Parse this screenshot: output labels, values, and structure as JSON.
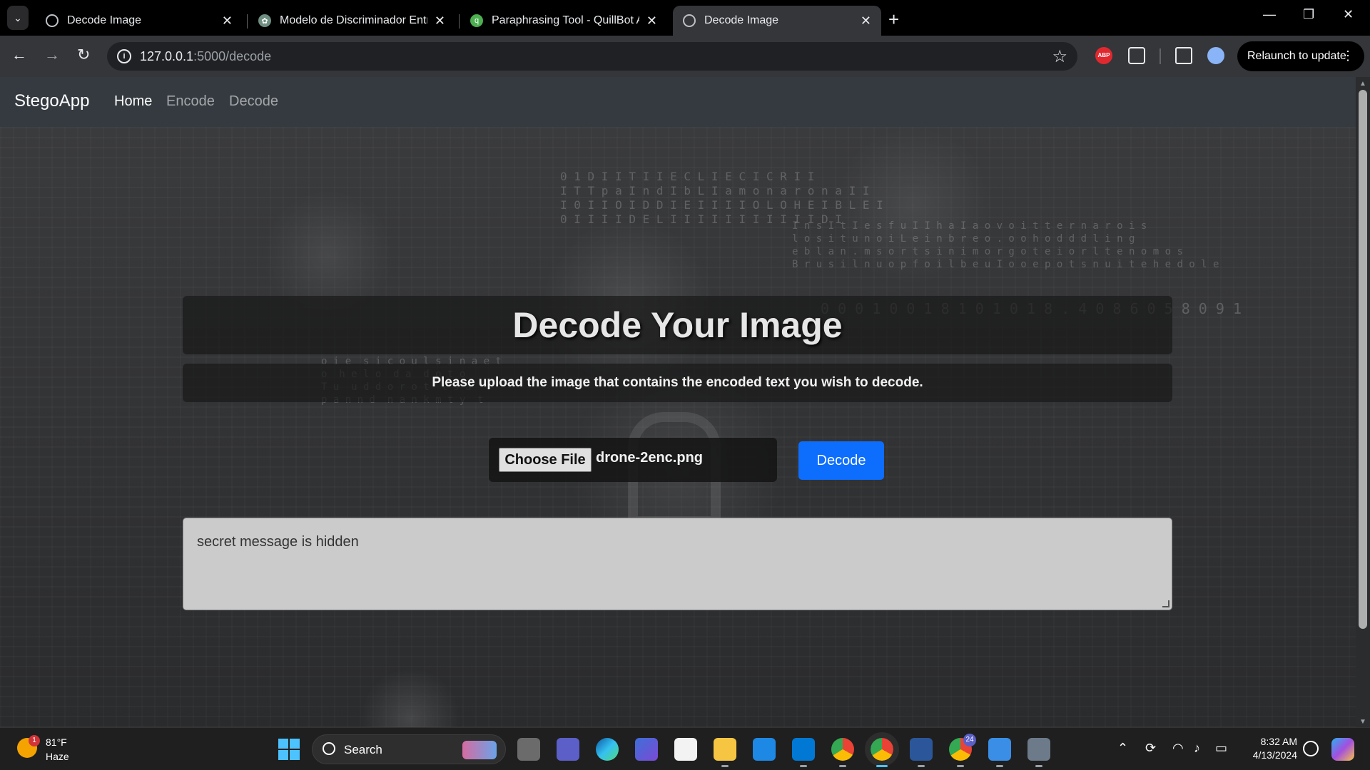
{
  "browser": {
    "tabs": [
      {
        "title": "Decode Image",
        "icon": "globe-icon"
      },
      {
        "title": "Modelo de Discriminador Entre",
        "icon": "chatgpt-icon"
      },
      {
        "title": "Paraphrasing Tool - QuillBot AI",
        "icon": "quillbot-icon"
      },
      {
        "title": "Decode Image",
        "icon": "globe-icon",
        "active": true
      }
    ],
    "url_host": "127.0.0.1",
    "url_path": ":5000/decode",
    "relaunch_label": "Relaunch to update",
    "abp_label": "ABP"
  },
  "navbar": {
    "brand": "StegoApp",
    "links": [
      "Home",
      "Encode",
      "Decode"
    ],
    "active": "Home"
  },
  "main": {
    "heading": "Decode Your Image",
    "subheading": "Please upload the image that contains the encoded text you wish to decode.",
    "file_button": "Choose File",
    "file_name": "drone-2enc.png",
    "decode_button": "Decode",
    "output_text": "secret message is hidden"
  },
  "taskbar": {
    "weather_temp": "81°F",
    "weather_desc": "Haze",
    "weather_badge": "1",
    "search_placeholder": "Search",
    "time": "8:32 AM",
    "date": "4/13/2024",
    "chrome_badge": "24"
  },
  "colors": {
    "accent": "#0d6efd",
    "navbar": "#343a40",
    "browser_frame": "#35363a"
  }
}
